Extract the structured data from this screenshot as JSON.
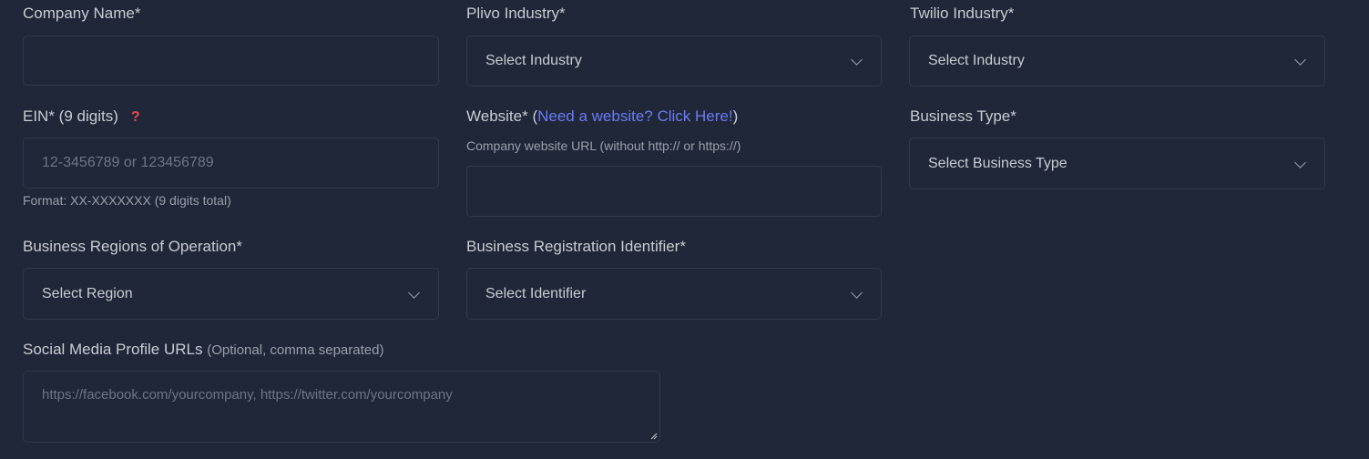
{
  "company_name": {
    "label": "Company Name*",
    "value": ""
  },
  "plivo_industry": {
    "label": "Plivo Industry*",
    "selected": "Select Industry"
  },
  "twilio_industry": {
    "label": "Twilio Industry*",
    "selected": "Select Industry"
  },
  "ein": {
    "label": "EIN* (9 digits)",
    "help_icon": "question-mark-icon",
    "placeholder": "12-3456789 or 123456789",
    "hint": "Format: XX-XXXXXXX (9 digits total)"
  },
  "website": {
    "label_prefix": "Website* (",
    "link_text": "Need a website? Click Here!",
    "label_suffix": ")",
    "hint": "Company website URL (without http:// or https://)",
    "value": ""
  },
  "business_type": {
    "label": "Business Type*",
    "selected": "Select Business Type"
  },
  "regions": {
    "label": "Business Regions of Operation*",
    "selected": "Select Region"
  },
  "registration_identifier": {
    "label": "Business Registration Identifier*",
    "selected": "Select Identifier"
  },
  "social_media": {
    "label": "Social Media Profile URLs",
    "label_note": "(Optional, comma separated)",
    "placeholder": "https://facebook.com/yourcompany, https://twitter.com/yourcompany"
  },
  "colors": {
    "background": "#1f2738",
    "border": "#323b4d",
    "link": "#6b7cf5",
    "help_icon": "#e5484d"
  }
}
